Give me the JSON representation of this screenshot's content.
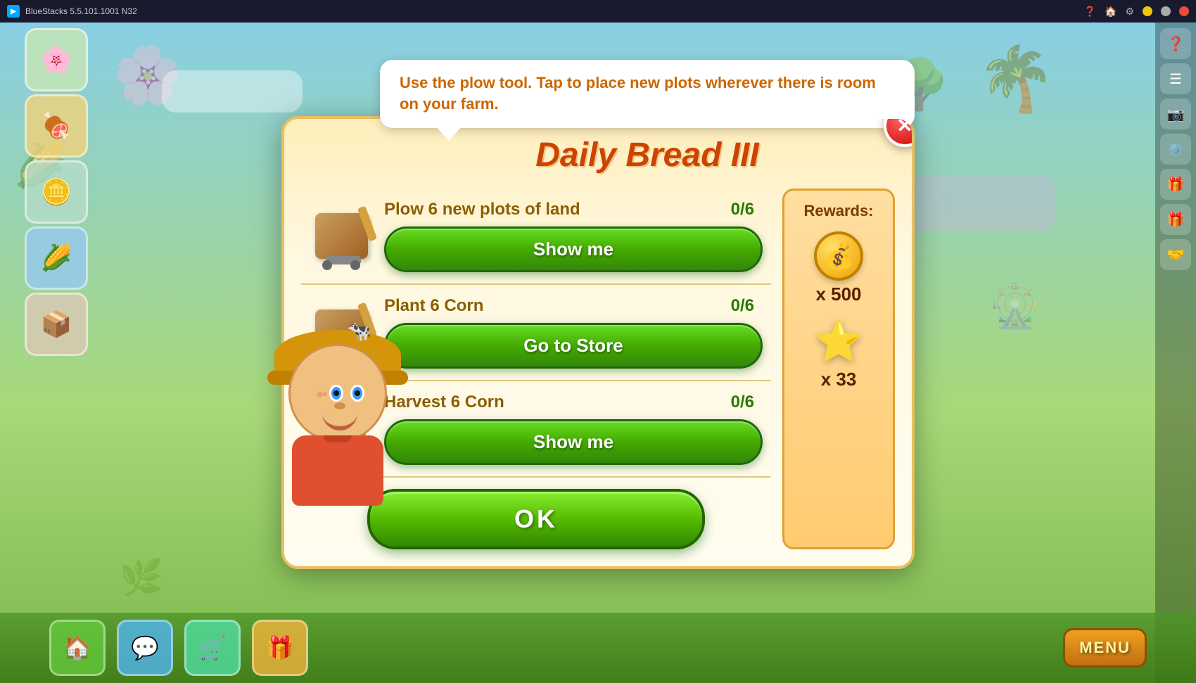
{
  "titlebar": {
    "app_name": "BlueStacks 5.5.101.1001 N32",
    "logo_text": "BS"
  },
  "tooltip": {
    "text": "Use the plow tool. Tap to place new plots wherever there is room on your farm."
  },
  "dialog": {
    "title": "Daily Bread III",
    "close_label": "✕",
    "tasks": [
      {
        "id": "plow",
        "name": "Plow 6 new plots of land",
        "progress": "0/6",
        "action_label": "Show me",
        "action_type": "show_me",
        "icon": "🪵"
      },
      {
        "id": "plant-corn",
        "name": "Plant 6 Corn",
        "progress": "0/6",
        "action_label": "Go to Store",
        "action_type": "go_to_store",
        "icon": "🌽"
      },
      {
        "id": "harvest-corn",
        "name": "Harvest 6 Corn",
        "progress": "0/6",
        "action_label": "Show me",
        "action_type": "show_me",
        "icon": "🌽"
      }
    ],
    "rewards": {
      "title": "Rewards:",
      "items": [
        {
          "type": "coin",
          "amount": "x 500",
          "icon": "💰"
        },
        {
          "type": "star",
          "amount": "x 33",
          "icon": "⭐"
        }
      ]
    },
    "ok_label": "OK"
  },
  "sidebar": {
    "icons": [
      "❓",
      "☰",
      "📷",
      "⚙️",
      "🤝"
    ]
  },
  "bottom_bar": {
    "menu_label": "MENU",
    "icons": [
      "🏠",
      "💬",
      "🛒",
      "🎁"
    ]
  }
}
